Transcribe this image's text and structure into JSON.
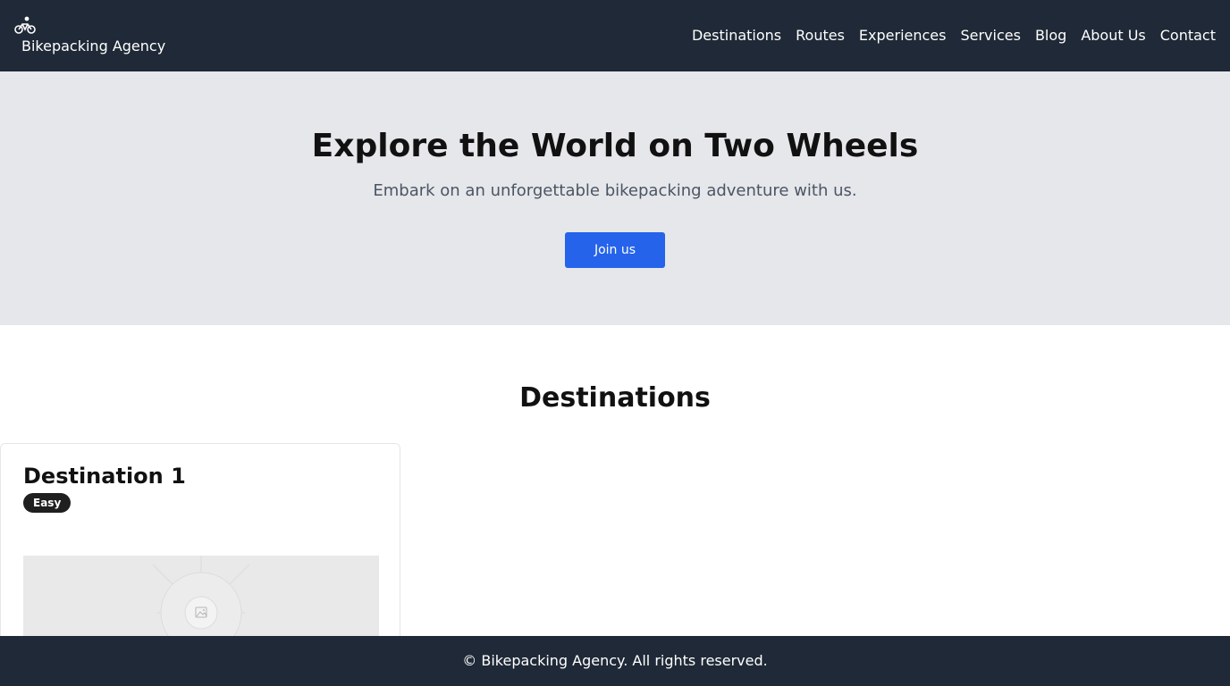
{
  "header": {
    "brand_icon": "bicycle-icon",
    "brand_name": "Bikepacking Agency",
    "nav": [
      "Destinations",
      "Routes",
      "Experiences",
      "Services",
      "Blog",
      "About Us",
      "Contact"
    ]
  },
  "hero": {
    "title": "Explore the World on Two Wheels",
    "subtitle": "Embark on an unforgettable bikepacking adventure with us.",
    "cta_label": "Join us"
  },
  "destinations": {
    "title": "Destinations",
    "cards": [
      {
        "title": "Destination 1",
        "difficulty": "Easy",
        "image_icon": "image-placeholder-icon"
      }
    ]
  },
  "footer": {
    "text": "© Bikepacking Agency. All rights reserved."
  },
  "colors": {
    "header_bg": "#1f2937",
    "hero_bg": "#e5e7eb",
    "accent": "#2563eb",
    "badge_bg": "#1f1f1f"
  }
}
